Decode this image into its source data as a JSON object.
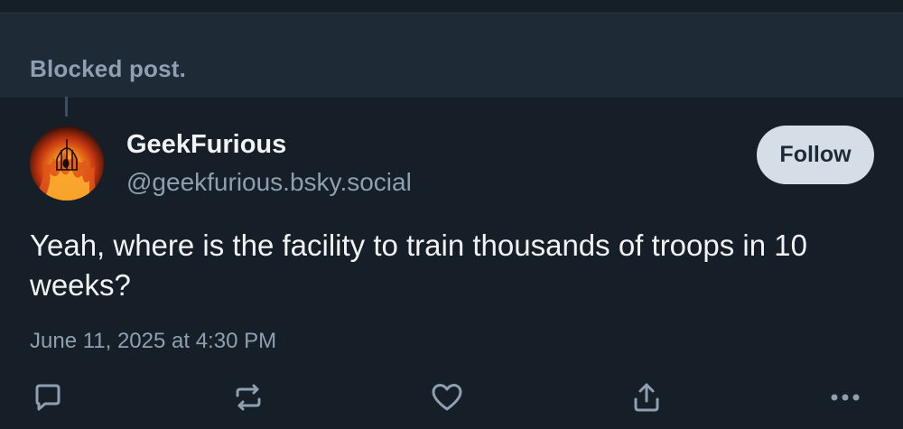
{
  "blocked": {
    "label": "Blocked post."
  },
  "author": {
    "display_name": "GeekFurious",
    "handle": "@geekfurious.bsky.social",
    "avatar_icon": "flaming-birdcage-avatar"
  },
  "follow_button": {
    "label": "Follow"
  },
  "post": {
    "text": "Yeah, where is the facility to train thousands of troops in 10 weeks?",
    "timestamp": "June 11, 2025 at 4:30 PM"
  },
  "actions": [
    {
      "icon": "reply-icon"
    },
    {
      "icon": "repost-icon"
    },
    {
      "icon": "like-icon"
    },
    {
      "icon": "share-icon"
    },
    {
      "icon": "more-icon"
    }
  ],
  "colors": {
    "background": "#161e27",
    "banner": "#1f2a37",
    "primary_text": "#f1f3f5",
    "secondary_text": "#8f9fb2",
    "follow_bg": "#d5dde6"
  }
}
